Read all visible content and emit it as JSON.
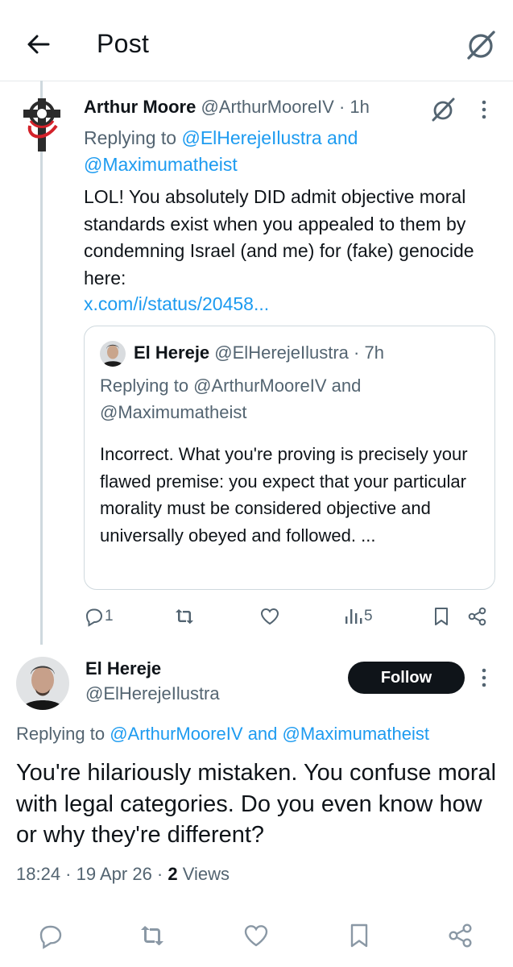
{
  "header": {
    "title": "Post",
    "back_icon": "arrow-left-icon",
    "grok_icon": "grok-icon"
  },
  "post1": {
    "name": "Arthur Moore",
    "handle": "@ArthurMooreIV",
    "sep": "·",
    "time": "1h",
    "replying_prefix": "Replying to ",
    "replying_users1": "@ElHerejeIlustra",
    "replying_and": " and",
    "replying_users2": "@Maximumatheist",
    "body": "LOL! You absolutely DID admit objective moral standards exist when you appealed to them by condemning Israel (and me) for (fake) genocide here:",
    "link": "x.com/i/status/20458...",
    "quote": {
      "name": "El Hereje",
      "handle": "@ElHerejeIlustra",
      "sep": "·",
      "time": "7h",
      "replying_line1": "Replying to @ArthurMooreIV and",
      "replying_line2": "@Maximumatheist",
      "body": "Incorrect. What you're proving is precisely your flawed premise: you expect that your particular morality must be considered objective and universally obeyed and followed. ..."
    },
    "actions": {
      "reply_count": "1",
      "repost_count": "",
      "like_count": "",
      "views_count": "5"
    }
  },
  "main_post": {
    "name": "El Hereje",
    "handle": "@ElHerejeIlustra",
    "follow_label": "Follow",
    "replying_prefix": "Replying to ",
    "replying_user1": "@ArthurMooreIV",
    "replying_and": " and ",
    "replying_user2": "@Maximumatheist",
    "body": "You're hilariously mistaken. You confuse moral with legal categories. Do you even know how or why they're different?",
    "time": "18:24",
    "sep1": " · ",
    "date": "19 Apr 26",
    "sep2": " · ",
    "views_count": "2",
    "views_label": " Views"
  },
  "colors": {
    "accent": "#1d9bf0",
    "text": "#0f1419",
    "muted": "#536471",
    "border": "#cfd9de"
  }
}
